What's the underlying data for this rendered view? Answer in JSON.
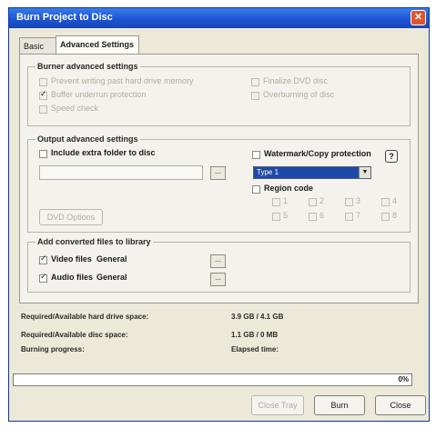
{
  "window": {
    "title": "Burn Project to Disc",
    "close_glyph": "✕"
  },
  "tabs": [
    {
      "label": "Basic"
    },
    {
      "label": "Advanced Settings"
    }
  ],
  "burner_group": {
    "legend": "Burner advanced settings",
    "options": [
      {
        "label": "Prevent writing past hard drive memory",
        "checked": false
      },
      {
        "label": "Buffer underrun protection",
        "checked": true
      },
      {
        "label": "Speed check",
        "checked": false
      },
      {
        "label": "Finalize DVD disc",
        "checked": false
      },
      {
        "label": "Overburning of disc",
        "checked": false
      }
    ]
  },
  "output_group": {
    "legend": "Output advanced settings",
    "include_label": "Include extra folder to disc",
    "folder_value": "",
    "browse_glyph": "...",
    "dvd_button": "DVD Options",
    "watermark_label": "Watermark/Copy protection",
    "help_glyph": "?",
    "type_value": "Type 1",
    "dropdown_arrow": "▼",
    "region_label": "Region code",
    "regions": [
      "1",
      "2",
      "3",
      "4",
      "5",
      "6",
      "7",
      "8"
    ]
  },
  "library_group": {
    "legend": "Add converted files to library",
    "video_label": "Video files",
    "video_value": "General",
    "audio_label": "Audio files",
    "audio_value": "General"
  },
  "info": {
    "space_label": "Required/Available hard drive space:",
    "space_value": "3.9 GB / 4.1 GB",
    "disc_label": "Required/Available disc space:",
    "disc_value": "1.1 GB / 0 MB",
    "progress_label": "Burning progress:",
    "progress_value": "Elapsed time:"
  },
  "progress": {
    "percent": "0%",
    "fraction": 0
  },
  "buttons": {
    "close_tray": "Close Tray",
    "burn": "Burn",
    "close": "Close"
  }
}
